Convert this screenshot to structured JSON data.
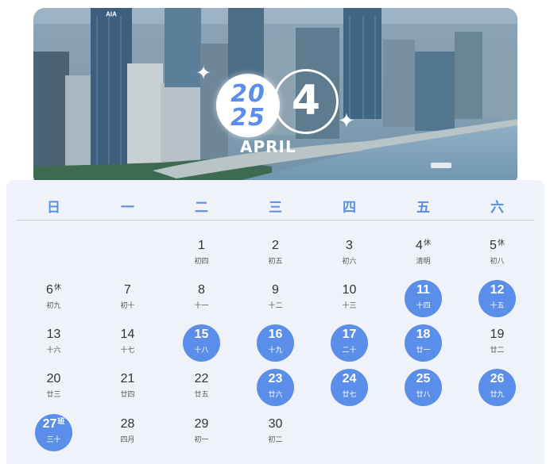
{
  "banner": {
    "year_top": "20",
    "year_bottom": "25",
    "month_number": "4",
    "month_name": "APRIL",
    "brand_on_building": "AIA",
    "sparkle_icon": "four-point-star-icon"
  },
  "calendar": {
    "weekdays": [
      "日",
      "一",
      "二",
      "三",
      "四",
      "五",
      "六"
    ],
    "accent_color": "#5b8ee8",
    "days": [
      {
        "day": "1",
        "lunar": "初四",
        "tag": "",
        "highlight": false
      },
      {
        "day": "2",
        "lunar": "初五",
        "tag": "",
        "highlight": false
      },
      {
        "day": "3",
        "lunar": "初六",
        "tag": "",
        "highlight": false
      },
      {
        "day": "4",
        "lunar": "清明",
        "tag": "休",
        "highlight": false
      },
      {
        "day": "5",
        "lunar": "初八",
        "tag": "休",
        "highlight": false
      },
      {
        "day": "6",
        "lunar": "初九",
        "tag": "休",
        "highlight": false
      },
      {
        "day": "7",
        "lunar": "初十",
        "tag": "",
        "highlight": false
      },
      {
        "day": "8",
        "lunar": "十一",
        "tag": "",
        "highlight": false
      },
      {
        "day": "9",
        "lunar": "十二",
        "tag": "",
        "highlight": false
      },
      {
        "day": "10",
        "lunar": "十三",
        "tag": "",
        "highlight": false
      },
      {
        "day": "11",
        "lunar": "十四",
        "tag": "",
        "highlight": true
      },
      {
        "day": "12",
        "lunar": "十五",
        "tag": "",
        "highlight": true
      },
      {
        "day": "13",
        "lunar": "十六",
        "tag": "",
        "highlight": false
      },
      {
        "day": "14",
        "lunar": "十七",
        "tag": "",
        "highlight": false
      },
      {
        "day": "15",
        "lunar": "十八",
        "tag": "",
        "highlight": true
      },
      {
        "day": "16",
        "lunar": "十九",
        "tag": "",
        "highlight": true
      },
      {
        "day": "17",
        "lunar": "二十",
        "tag": "",
        "highlight": true
      },
      {
        "day": "18",
        "lunar": "廿一",
        "tag": "",
        "highlight": true
      },
      {
        "day": "19",
        "lunar": "廿二",
        "tag": "",
        "highlight": false
      },
      {
        "day": "20",
        "lunar": "廿三",
        "tag": "",
        "highlight": false
      },
      {
        "day": "21",
        "lunar": "廿四",
        "tag": "",
        "highlight": false
      },
      {
        "day": "22",
        "lunar": "廿五",
        "tag": "",
        "highlight": false
      },
      {
        "day": "23",
        "lunar": "廿六",
        "tag": "",
        "highlight": true
      },
      {
        "day": "24",
        "lunar": "廿七",
        "tag": "",
        "highlight": true
      },
      {
        "day": "25",
        "lunar": "廿八",
        "tag": "",
        "highlight": true
      },
      {
        "day": "26",
        "lunar": "廿九",
        "tag": "",
        "highlight": true
      },
      {
        "day": "27",
        "lunar": "三十",
        "tag": "班",
        "highlight": true
      },
      {
        "day": "28",
        "lunar": "四月",
        "tag": "",
        "highlight": false
      },
      {
        "day": "29",
        "lunar": "初一",
        "tag": "",
        "highlight": false
      },
      {
        "day": "30",
        "lunar": "初二",
        "tag": "",
        "highlight": false
      }
    ]
  }
}
